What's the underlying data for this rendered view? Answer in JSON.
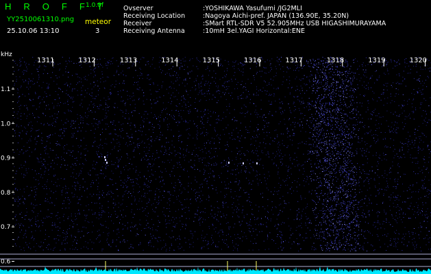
{
  "header": {
    "app_name": "H R O F F T",
    "version": "1.0.0f",
    "filename": "YY2510061310.png",
    "datetime": "25.10.06 13:10",
    "mode_label": "meteor",
    "count": "3",
    "info": [
      {
        "key": "Ovserver",
        "value": ":YOSHIKAWA Yasufumi /JG2MLI"
      },
      {
        "key": "Receiving Location",
        "value": ":Nagoya Aichi-pref. JAPAN (136.90E, 35.20N)"
      },
      {
        "key": "Receiver",
        "value": ":SMart RTL-SDR V5 52.905MHz USB HIGASHIMURAYAMA"
      },
      {
        "key": "Receiving Antenna",
        "value": ":10mH 3el.YAGI Horizontal:ENE"
      }
    ]
  },
  "colors": {
    "background": "#000000",
    "title_green": "#00ff00",
    "label_yellow": "#ffff00",
    "text_white": "#ffffff",
    "noise_blue": "#3b3bd0",
    "marker_yellow": "#ffff66",
    "spectrum_cyan": "#00e8ff",
    "baseline_lines": "#b0b0d8"
  },
  "waterfall": {
    "freq_unit": "kHz",
    "freq_ticks": [
      "1.1",
      "1.0",
      "0.9",
      "0.8",
      "0.7",
      "0.6"
    ],
    "time_labels": [
      "1311",
      "1312",
      "1313",
      "1314",
      "1315",
      "1316",
      "1317",
      "1318",
      "1319",
      "1320"
    ]
  }
}
